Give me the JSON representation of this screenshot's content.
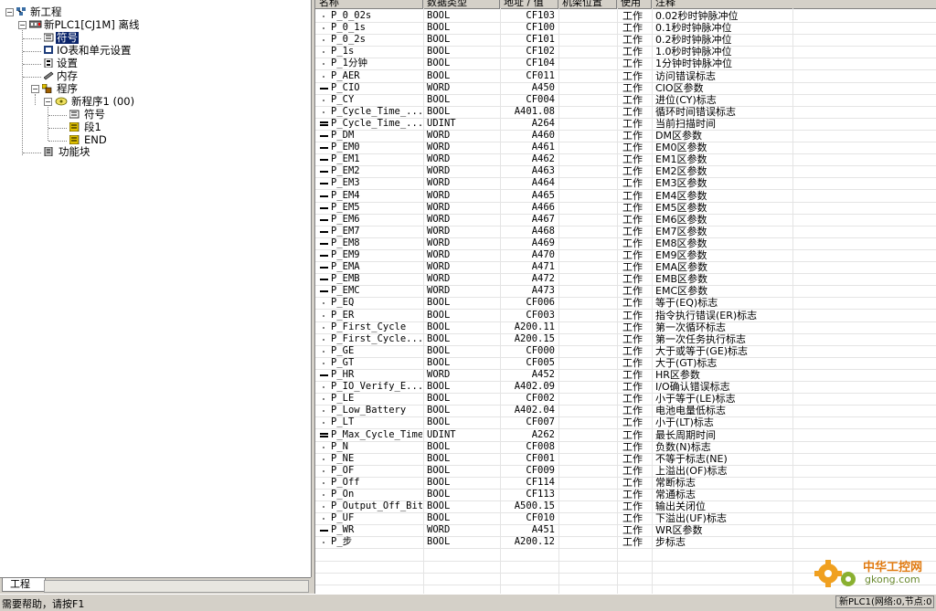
{
  "tree": {
    "project": "新工程",
    "plc": "新PLC1[CJ1M] 离线",
    "symbols": "符号",
    "io_table": "IO表和单元设置",
    "settings": "设置",
    "memory": "内存",
    "programs": "程序",
    "program1": "新程序1 (00)",
    "prog_symbols": "符号",
    "section1": "段1",
    "end": "END",
    "function_blocks": "功能块",
    "tab_label": "工程"
  },
  "grid": {
    "headers": [
      "名称",
      "数据类型",
      "地址 / 值",
      "机架位置",
      "使用",
      "注释"
    ],
    "rows": [
      {
        "mark": "dot",
        "name": "P_0_02s",
        "type": "BOOL",
        "addr": "CF103",
        "use": "工作",
        "comment": "0.02秒时钟脉冲位"
      },
      {
        "mark": "dot",
        "name": "P_0_1s",
        "type": "BOOL",
        "addr": "CF100",
        "use": "工作",
        "comment": "0.1秒时钟脉冲位"
      },
      {
        "mark": "dot",
        "name": "P_0_2s",
        "type": "BOOL",
        "addr": "CF101",
        "use": "工作",
        "comment": "0.2秒时钟脉冲位"
      },
      {
        "mark": "dot",
        "name": "P_1s",
        "type": "BOOL",
        "addr": "CF102",
        "use": "工作",
        "comment": "1.0秒时钟脉冲位"
      },
      {
        "mark": "dot",
        "name": "P_1分钟",
        "type": "BOOL",
        "addr": "CF104",
        "use": "工作",
        "comment": "1分钟时钟脉冲位"
      },
      {
        "mark": "dot",
        "name": "P_AER",
        "type": "BOOL",
        "addr": "CF011",
        "use": "工作",
        "comment": "访问错误标志"
      },
      {
        "mark": "dash",
        "name": "P_CIO",
        "type": "WORD",
        "addr": "A450",
        "use": "工作",
        "comment": "CIO区参数"
      },
      {
        "mark": "dot",
        "name": "P_CY",
        "type": "BOOL",
        "addr": "CF004",
        "use": "工作",
        "comment": "进位(CY)标志"
      },
      {
        "mark": "dot",
        "name": "P_Cycle_Time_...",
        "type": "BOOL",
        "addr": "A401.08",
        "use": "工作",
        "comment": "循环时间错误标志"
      },
      {
        "mark": "eq",
        "name": "P_Cycle_Time_...",
        "type": "UDINT",
        "addr": "A264",
        "use": "工作",
        "comment": "当前扫描时间"
      },
      {
        "mark": "dash",
        "name": "P_DM",
        "type": "WORD",
        "addr": "A460",
        "use": "工作",
        "comment": "DM区参数"
      },
      {
        "mark": "dash",
        "name": "P_EM0",
        "type": "WORD",
        "addr": "A461",
        "use": "工作",
        "comment": "EM0区参数"
      },
      {
        "mark": "dash",
        "name": "P_EM1",
        "type": "WORD",
        "addr": "A462",
        "use": "工作",
        "comment": "EM1区参数"
      },
      {
        "mark": "dash",
        "name": "P_EM2",
        "type": "WORD",
        "addr": "A463",
        "use": "工作",
        "comment": "EM2区参数"
      },
      {
        "mark": "dash",
        "name": "P_EM3",
        "type": "WORD",
        "addr": "A464",
        "use": "工作",
        "comment": "EM3区参数"
      },
      {
        "mark": "dash",
        "name": "P_EM4",
        "type": "WORD",
        "addr": "A465",
        "use": "工作",
        "comment": "EM4区参数"
      },
      {
        "mark": "dash",
        "name": "P_EM5",
        "type": "WORD",
        "addr": "A466",
        "use": "工作",
        "comment": "EM5区参数"
      },
      {
        "mark": "dash",
        "name": "P_EM6",
        "type": "WORD",
        "addr": "A467",
        "use": "工作",
        "comment": "EM6区参数"
      },
      {
        "mark": "dash",
        "name": "P_EM7",
        "type": "WORD",
        "addr": "A468",
        "use": "工作",
        "comment": "EM7区参数"
      },
      {
        "mark": "dash",
        "name": "P_EM8",
        "type": "WORD",
        "addr": "A469",
        "use": "工作",
        "comment": "EM8区参数"
      },
      {
        "mark": "dash",
        "name": "P_EM9",
        "type": "WORD",
        "addr": "A470",
        "use": "工作",
        "comment": "EM9区参数"
      },
      {
        "mark": "dash",
        "name": "P_EMA",
        "type": "WORD",
        "addr": "A471",
        "use": "工作",
        "comment": "EMA区参数"
      },
      {
        "mark": "dash",
        "name": "P_EMB",
        "type": "WORD",
        "addr": "A472",
        "use": "工作",
        "comment": "EMB区参数"
      },
      {
        "mark": "dash",
        "name": "P_EMC",
        "type": "WORD",
        "addr": "A473",
        "use": "工作",
        "comment": "EMC区参数"
      },
      {
        "mark": "dot",
        "name": "P_EQ",
        "type": "BOOL",
        "addr": "CF006",
        "use": "工作",
        "comment": "等于(EQ)标志"
      },
      {
        "mark": "dot",
        "name": "P_ER",
        "type": "BOOL",
        "addr": "CF003",
        "use": "工作",
        "comment": "指令执行错误(ER)标志"
      },
      {
        "mark": "dot",
        "name": "P_First_Cycle",
        "type": "BOOL",
        "addr": "A200.11",
        "use": "工作",
        "comment": "第一次循环标志"
      },
      {
        "mark": "dot",
        "name": "P_First_Cycle...",
        "type": "BOOL",
        "addr": "A200.15",
        "use": "工作",
        "comment": "第一次任务执行标志"
      },
      {
        "mark": "dot",
        "name": "P_GE",
        "type": "BOOL",
        "addr": "CF000",
        "use": "工作",
        "comment": "大于或等于(GE)标志"
      },
      {
        "mark": "dot",
        "name": "P_GT",
        "type": "BOOL",
        "addr": "CF005",
        "use": "工作",
        "comment": "大于(GT)标志"
      },
      {
        "mark": "dash",
        "name": "P_HR",
        "type": "WORD",
        "addr": "A452",
        "use": "工作",
        "comment": "HR区参数"
      },
      {
        "mark": "dot",
        "name": "P_IO_Verify_E...",
        "type": "BOOL",
        "addr": "A402.09",
        "use": "工作",
        "comment": "I/O确认错误标志"
      },
      {
        "mark": "dot",
        "name": "P_LE",
        "type": "BOOL",
        "addr": "CF002",
        "use": "工作",
        "comment": "小于等于(LE)标志"
      },
      {
        "mark": "dot",
        "name": "P_Low_Battery",
        "type": "BOOL",
        "addr": "A402.04",
        "use": "工作",
        "comment": "电池电量低标志"
      },
      {
        "mark": "dot",
        "name": "P_LT",
        "type": "BOOL",
        "addr": "CF007",
        "use": "工作",
        "comment": "小于(LT)标志"
      },
      {
        "mark": "eq",
        "name": "P_Max_Cycle_Time",
        "type": "UDINT",
        "addr": "A262",
        "use": "工作",
        "comment": "最长周期时间"
      },
      {
        "mark": "dot",
        "name": "P_N",
        "type": "BOOL",
        "addr": "CF008",
        "use": "工作",
        "comment": "负数(N)标志"
      },
      {
        "mark": "dot",
        "name": "P_NE",
        "type": "BOOL",
        "addr": "CF001",
        "use": "工作",
        "comment": "不等于标志(NE)"
      },
      {
        "mark": "dot",
        "name": "P_OF",
        "type": "BOOL",
        "addr": "CF009",
        "use": "工作",
        "comment": "上溢出(OF)标志"
      },
      {
        "mark": "dot",
        "name": "P_Off",
        "type": "BOOL",
        "addr": "CF114",
        "use": "工作",
        "comment": "常断标志"
      },
      {
        "mark": "dot",
        "name": "P_On",
        "type": "BOOL",
        "addr": "CF113",
        "use": "工作",
        "comment": "常通标志"
      },
      {
        "mark": "dot",
        "name": "P_Output_Off_Bit",
        "type": "BOOL",
        "addr": "A500.15",
        "use": "工作",
        "comment": "输出关闭位"
      },
      {
        "mark": "dot",
        "name": "P_UF",
        "type": "BOOL",
        "addr": "CF010",
        "use": "工作",
        "comment": "下溢出(UF)标志"
      },
      {
        "mark": "dash",
        "name": "P_WR",
        "type": "WORD",
        "addr": "A451",
        "use": "工作",
        "comment": "WR区参数"
      },
      {
        "mark": "dot",
        "name": "P_步",
        "type": "BOOL",
        "addr": "A200.12",
        "use": "工作",
        "comment": "步标志"
      }
    ],
    "empty_rows": 4
  },
  "status": {
    "help": "需要帮助，请按F1",
    "right": "新PLC1(网络:0,节点:0"
  },
  "watermark": {
    "line1": "中华工控网",
    "line2": "gkong.com"
  }
}
